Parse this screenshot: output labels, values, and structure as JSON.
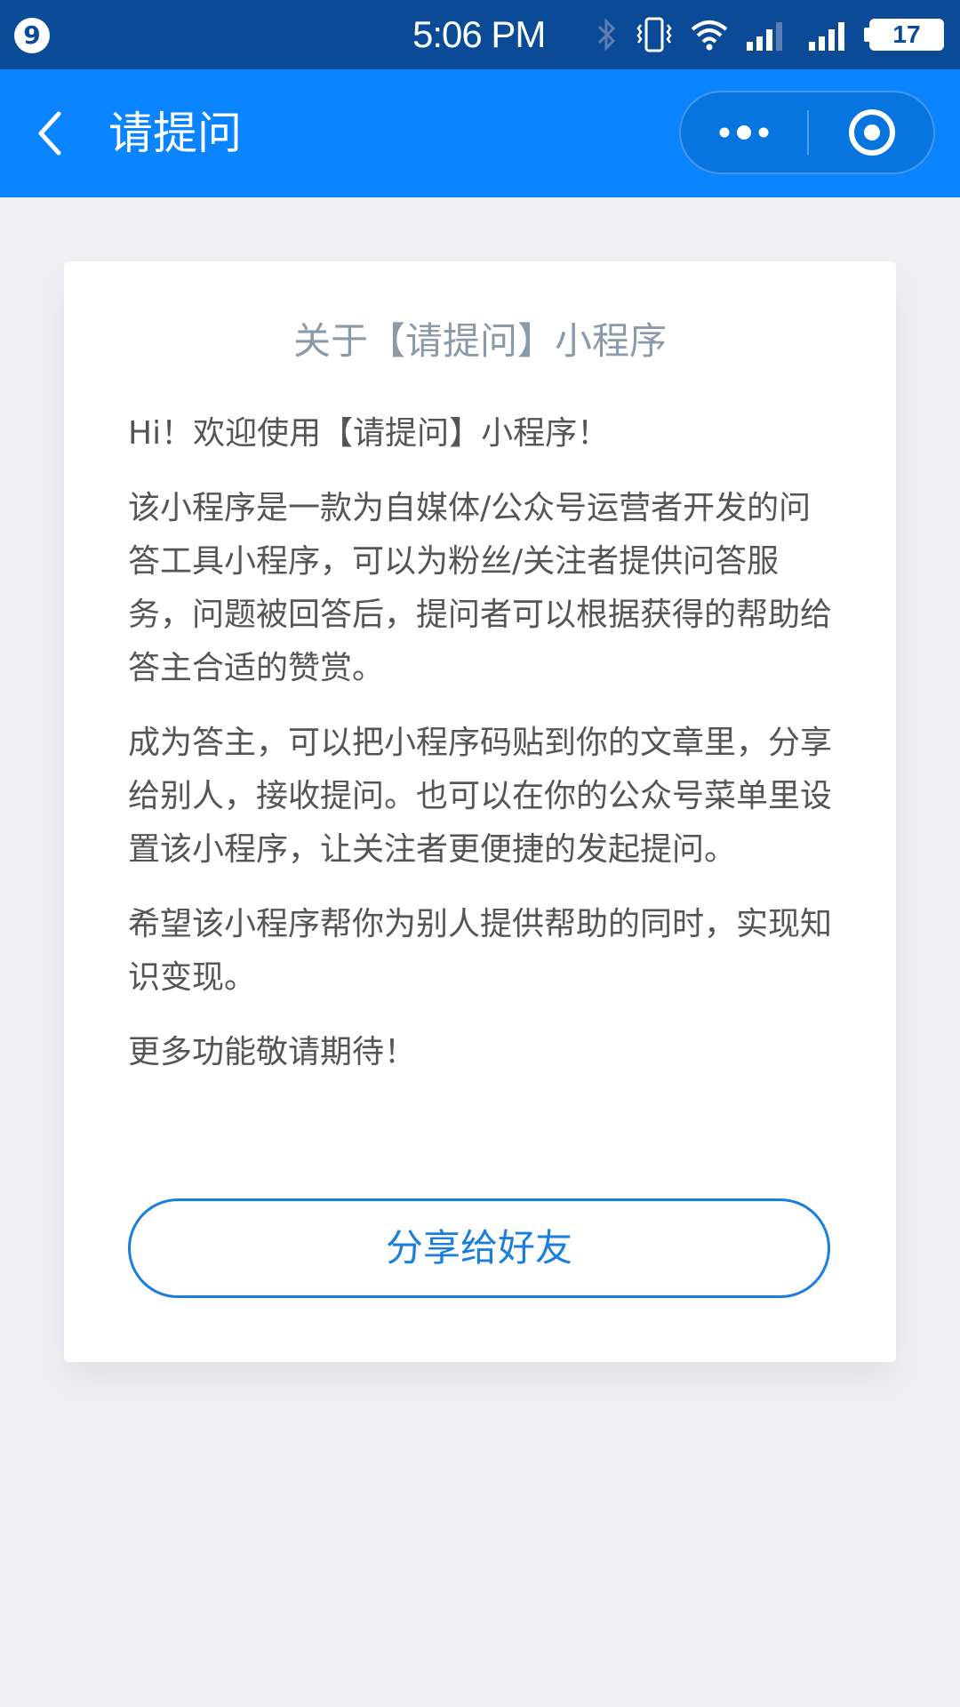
{
  "status_bar": {
    "notification_count": "9",
    "time": "5:06 PM",
    "battery_level": "17",
    "icons": [
      "bluetooth-icon",
      "vibrate-icon",
      "wifi-icon",
      "signal-2-icon",
      "signal-1-icon",
      "battery-icon"
    ]
  },
  "nav_bar": {
    "title": "请提问",
    "background_color": "#0a84ff",
    "icons": [
      "back-arrow-icon",
      "more-dots-icon",
      "close-target-icon"
    ]
  },
  "card": {
    "title": "关于【请提问】小程序",
    "paragraphs": [
      "Hi！欢迎使用【请提问】小程序！",
      "该小程序是一款为自媒体/公众号运营者开发的问答工具小程序，可以为粉丝/关注者提供问答服务，问题被回答后，提问者可以根据获得的帮助给答主合适的赞赏。",
      "成为答主，可以把小程序码贴到你的文章里，分享给别人，接收提问。也可以在你的公众号菜单里设置该小程序，让关注者更便捷的发起提问。",
      "希望该小程序帮你为别人提供帮助的同时，实现知识变现。",
      "更多功能敬请期待！"
    ],
    "share_button_label": "分享给好友",
    "accent_color": "#1a7fdc"
  }
}
